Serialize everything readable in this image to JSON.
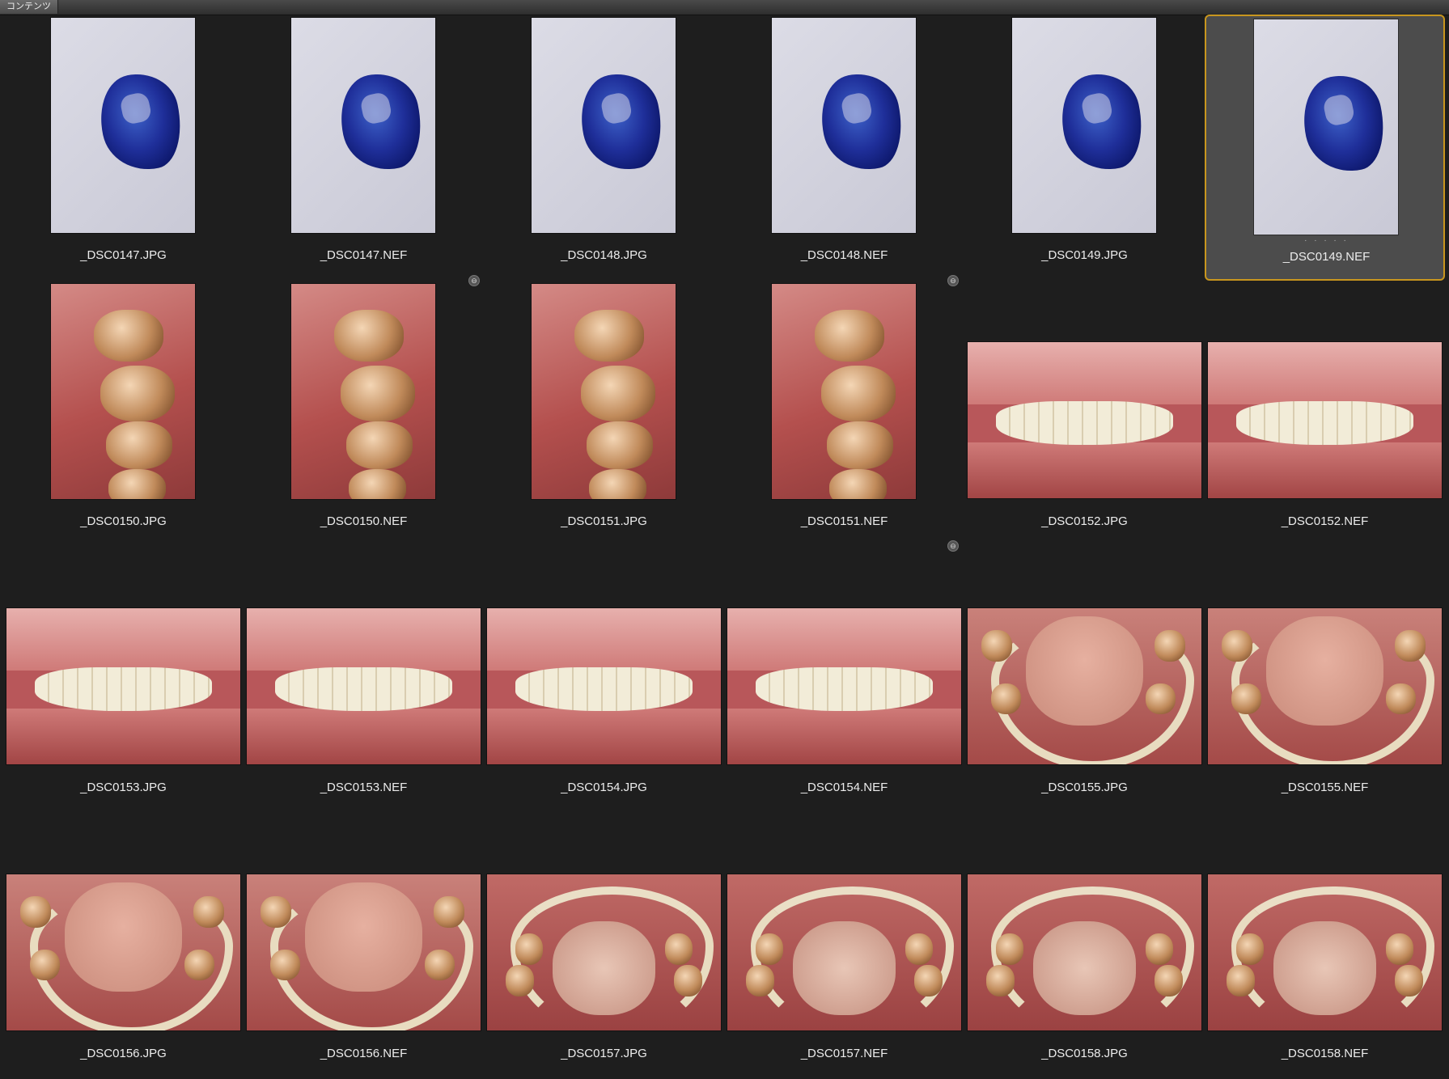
{
  "panel": {
    "tab_label": "コンテンツ"
  },
  "items": [
    {
      "name": "_DSC0147.JPG",
      "kind": "model",
      "orientation": "portrait"
    },
    {
      "name": "_DSC0147.NEF",
      "kind": "model",
      "orientation": "portrait"
    },
    {
      "name": "_DSC0148.JPG",
      "kind": "model",
      "orientation": "portrait"
    },
    {
      "name": "_DSC0148.NEF",
      "kind": "model",
      "orientation": "portrait"
    },
    {
      "name": "_DSC0149.JPG",
      "kind": "model",
      "orientation": "portrait"
    },
    {
      "name": "_DSC0149.NEF",
      "kind": "model",
      "orientation": "portrait",
      "selected": true,
      "rating_dots": "· · · · ·"
    },
    {
      "name": "_DSC0150.JPG",
      "kind": "molars",
      "orientation": "portrait"
    },
    {
      "name": "_DSC0150.NEF",
      "kind": "molars",
      "orientation": "portrait"
    },
    {
      "name": "_DSC0151.JPG",
      "kind": "molars",
      "orientation": "portrait"
    },
    {
      "name": "_DSC0151.NEF",
      "kind": "molars",
      "orientation": "portrait"
    },
    {
      "name": "_DSC0152.JPG",
      "kind": "front",
      "orientation": "landscape"
    },
    {
      "name": "_DSC0152.NEF",
      "kind": "front",
      "orientation": "landscape"
    },
    {
      "name": "_DSC0153.JPG",
      "kind": "front",
      "orientation": "landscape"
    },
    {
      "name": "_DSC0153.NEF",
      "kind": "front",
      "orientation": "landscape"
    },
    {
      "name": "_DSC0154.JPG",
      "kind": "front",
      "orientation": "landscape"
    },
    {
      "name": "_DSC0154.NEF",
      "kind": "front",
      "orientation": "landscape"
    },
    {
      "name": "_DSC0155.JPG",
      "kind": "lower-arch",
      "orientation": "landscape"
    },
    {
      "name": "_DSC0155.NEF",
      "kind": "lower-arch",
      "orientation": "landscape"
    },
    {
      "name": "_DSC0156.JPG",
      "kind": "lower-arch",
      "orientation": "landscape"
    },
    {
      "name": "_DSC0156.NEF",
      "kind": "lower-arch",
      "orientation": "landscape"
    },
    {
      "name": "_DSC0157.JPG",
      "kind": "upper-arch",
      "orientation": "landscape"
    },
    {
      "name": "_DSC0157.NEF",
      "kind": "upper-arch",
      "orientation": "landscape"
    },
    {
      "name": "_DSC0158.JPG",
      "kind": "upper-arch",
      "orientation": "landscape"
    },
    {
      "name": "_DSC0158.NEF",
      "kind": "upper-arch",
      "orientation": "landscape"
    }
  ],
  "link_icons": [
    {
      "icon": "stack-link-icon"
    },
    {
      "icon": "stack-link-icon"
    },
    {
      "icon": "stack-link-icon"
    }
  ],
  "colors": {
    "selection_border": "#c8961e",
    "background": "#1e1e1e"
  }
}
